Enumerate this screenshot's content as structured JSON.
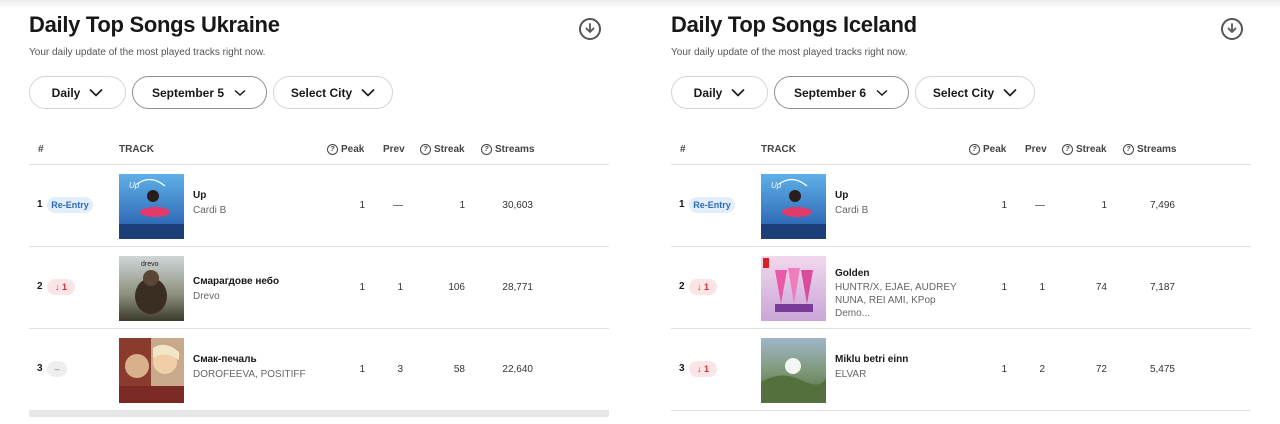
{
  "panels": [
    {
      "title": "Daily Top Songs Ukraine",
      "subtitle": "Your daily update of the most played tracks right now.",
      "filters": {
        "period": "Daily",
        "date": "September 5",
        "city": "Select City"
      },
      "columns": {
        "rank": "#",
        "track": "TRACK",
        "peak": "Peak",
        "prev": "Prev",
        "streak": "Streak",
        "streams": "Streams"
      },
      "rows": [
        {
          "rank": "1",
          "badge": "Re-Entry",
          "badge_type": "reentry",
          "song": "Up",
          "artist": "Cardi B",
          "peak": "1",
          "prev": "—",
          "streak": "1",
          "streams": "30,603"
        },
        {
          "rank": "2",
          "badge": "↓ 1",
          "badge_type": "down",
          "song": "Смарагдове небо",
          "artist": "Drevo",
          "peak": "1",
          "prev": "1",
          "streak": "106",
          "streams": "28,771"
        },
        {
          "rank": "3",
          "badge": "–",
          "badge_type": "same",
          "song": "Смак-печаль",
          "artist": "DOROFEEVA, POSITIFF",
          "peak": "1",
          "prev": "3",
          "streak": "58",
          "streams": "22,640"
        }
      ]
    },
    {
      "title": "Daily Top Songs Iceland",
      "subtitle": "Your daily update of the most played tracks right now.",
      "filters": {
        "period": "Daily",
        "date": "September 6",
        "city": "Select City"
      },
      "columns": {
        "rank": "#",
        "track": "TRACK",
        "peak": "Peak",
        "prev": "Prev",
        "streak": "Streak",
        "streams": "Streams"
      },
      "rows": [
        {
          "rank": "1",
          "badge": "Re-Entry",
          "badge_type": "reentry",
          "song": "Up",
          "artist": "Cardi B",
          "peak": "1",
          "prev": "—",
          "streak": "1",
          "streams": "7,496"
        },
        {
          "rank": "2",
          "badge": "↓ 1",
          "badge_type": "down",
          "song": "Golden",
          "artist": "HUNTR/X, EJAE, AUDREY NUNA, REI AMI, KPop Demo...",
          "peak": "1",
          "prev": "1",
          "streak": "74",
          "streams": "7,187"
        },
        {
          "rank": "3",
          "badge": "↓ 1",
          "badge_type": "down",
          "song": "Miklu betri einn",
          "artist": "ELVAR",
          "peak": "1",
          "prev": "2",
          "streak": "72",
          "streams": "5,475"
        }
      ]
    }
  ],
  "icons": {
    "download": "download-circle-icon",
    "dropdown": "chevron-down-icon",
    "help": "question-circle-icon"
  }
}
